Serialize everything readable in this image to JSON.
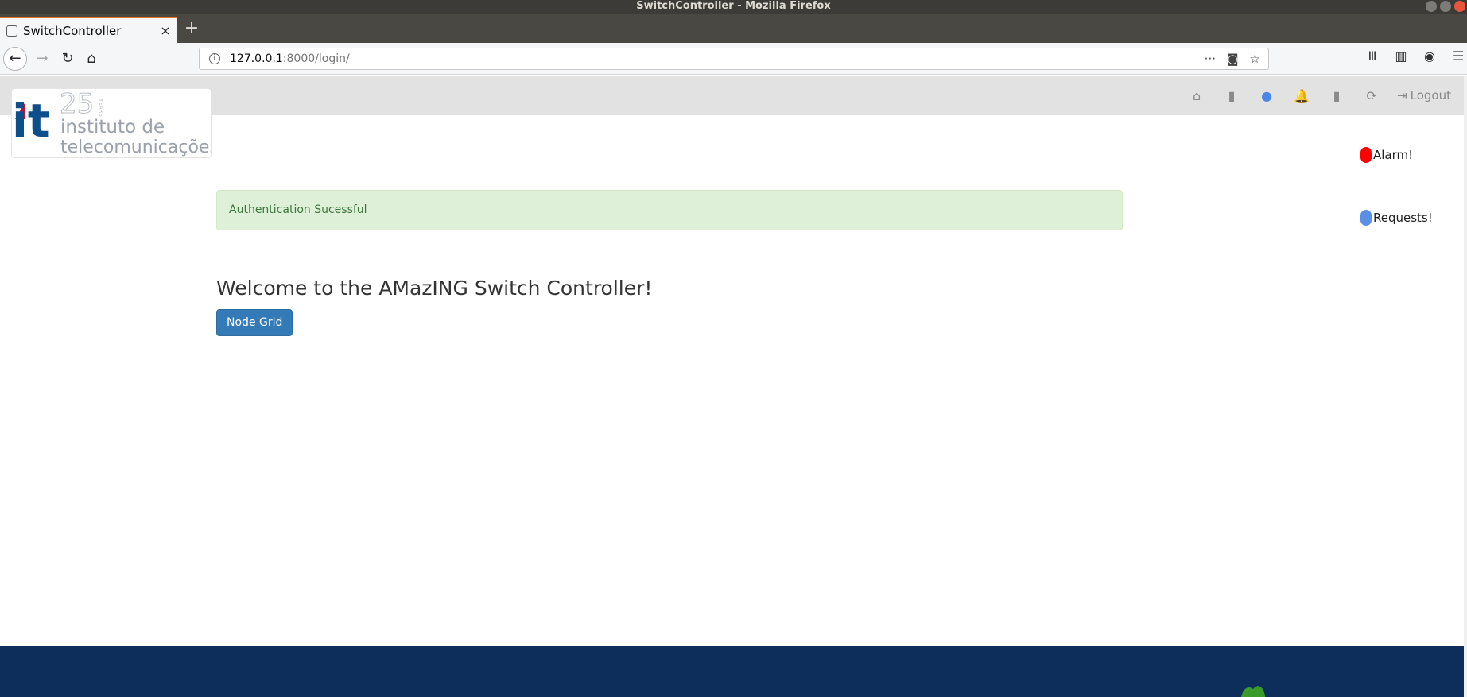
{
  "window": {
    "title": "SwitchController - Mozilla Firefox"
  },
  "browser": {
    "tab": {
      "title": "SwitchController",
      "close_glyph": "×"
    },
    "new_tab_glyph": "+",
    "url": {
      "host": "127.0.0.1",
      "rest": ":8000/login/"
    },
    "icons": {
      "back": "←",
      "forward": "→",
      "reload": "↻",
      "home": "⌂",
      "more": "···",
      "pocket": "◙",
      "star": "☆",
      "library": "Ⅲ",
      "sidebar": "▥",
      "account": "◉",
      "menu": "☰"
    }
  },
  "app_nav": {
    "items": [
      {
        "name": "home",
        "glyph": "⌂"
      },
      {
        "name": "book",
        "glyph": "▮"
      },
      {
        "name": "info",
        "glyph": "●"
      },
      {
        "name": "bell",
        "glyph": "🔔"
      },
      {
        "name": "stats",
        "glyph": "▮"
      },
      {
        "name": "refresh",
        "glyph": "⟳"
      }
    ],
    "logout_label": "Logout",
    "logout_glyph": "⇥"
  },
  "logo": {
    "mark": "it",
    "years": "25",
    "years_label": "YEARS",
    "line1": "instituto de",
    "line2": "telecomunicações"
  },
  "side_badges": {
    "alarm_label": "Alarm!",
    "requests_label": "Requests!"
  },
  "alert": {
    "text": "Authentication Sucessful"
  },
  "main": {
    "welcome": "Welcome to the AMazING Switch Controller!",
    "node_grid_button": "Node Grid"
  },
  "colors": {
    "alert_bg": "#dff0d8",
    "alert_text": "#3c763d",
    "primary_button": "#337ab7",
    "footer": "#0d2d5a",
    "alarm": "#ff0000",
    "requests": "#5b8fe6",
    "info_icon": "#4a86e8",
    "bell_icon": "#ee2222"
  }
}
